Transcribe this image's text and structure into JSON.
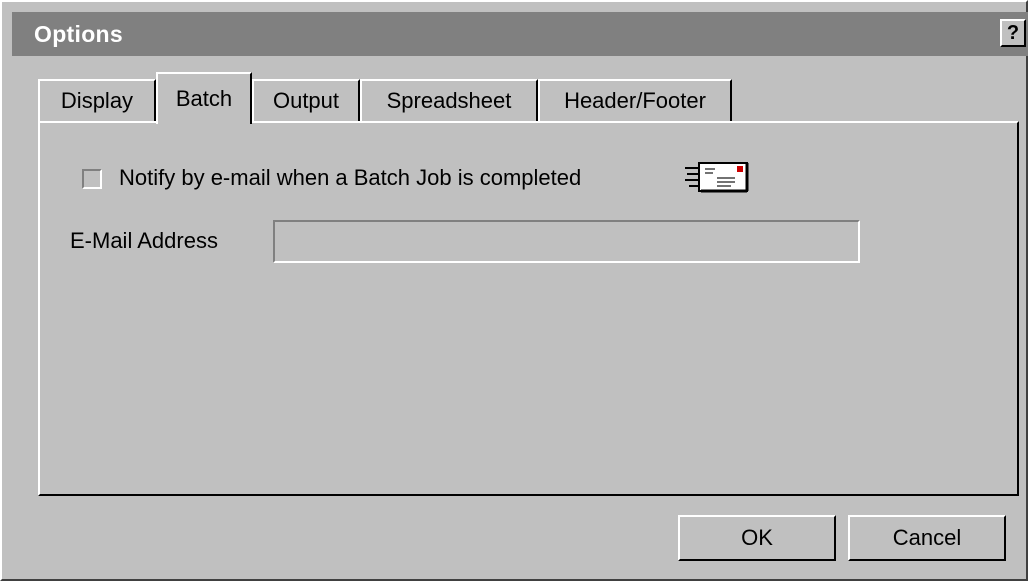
{
  "window": {
    "title": "Options",
    "help_label": "?"
  },
  "tabs": [
    {
      "label": "Display",
      "active": false
    },
    {
      "label": "Batch",
      "active": true
    },
    {
      "label": "Output",
      "active": false
    },
    {
      "label": "Spreadsheet",
      "active": false
    },
    {
      "label": "Header/Footer",
      "active": false
    }
  ],
  "batch": {
    "notify_checkbox_label": "Notify by e-mail when a Batch Job is completed",
    "notify_checked": false,
    "email_label": "E-Mail Address",
    "email_value": "",
    "email_placeholder": "",
    "mail_icon": "envelope-icon"
  },
  "buttons": {
    "ok_label": "OK",
    "cancel_label": "Cancel"
  },
  "colors": {
    "face": "#c0c0c0",
    "titlebar": "#808080",
    "stamp": "#cc0000"
  }
}
